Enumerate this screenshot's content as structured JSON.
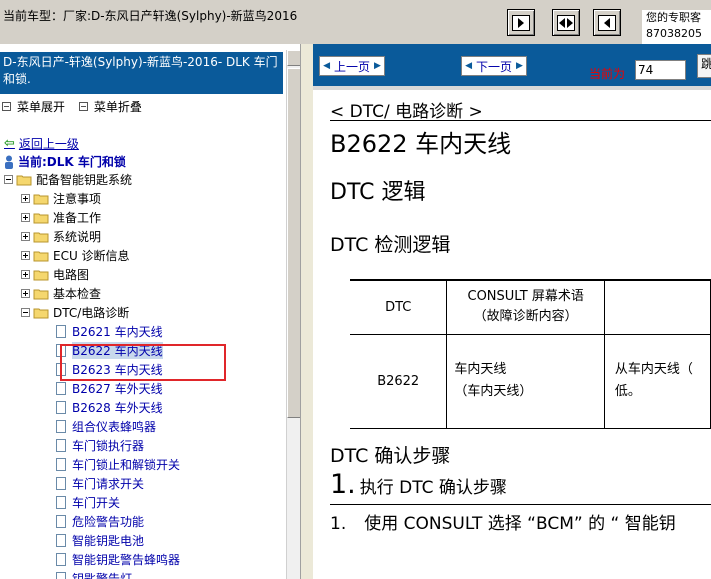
{
  "topbar": {
    "vehicle_label": "当前车型：厂家:D-东风日产轩逸(Sylphy)-新蓝鸟2016",
    "contact_line1": "您的专职客",
    "contact_line2": "87038205"
  },
  "left": {
    "title": "D-东风日产-轩逸(Sylphy)-新蓝鸟-2016- DLK 车门和锁.",
    "expand_label": "菜单展开",
    "collapse_label": "菜单折叠",
    "back_label": "返回上一级",
    "current_label": "当前:DLK 车门和锁",
    "tree": [
      {
        "label": "配备智能钥匙系统",
        "kind": "folder",
        "expanded": true
      },
      {
        "label": "注意事项",
        "kind": "folder",
        "expanded": false
      },
      {
        "label": "准备工作",
        "kind": "folder",
        "expanded": false
      },
      {
        "label": "系统说明",
        "kind": "folder",
        "expanded": false
      },
      {
        "label": "ECU 诊断信息",
        "kind": "folder",
        "expanded": false
      },
      {
        "label": "电路图",
        "kind": "folder",
        "expanded": false
      },
      {
        "label": "基本检查",
        "kind": "folder",
        "expanded": false
      },
      {
        "label": "DTC/电路诊断",
        "kind": "folder",
        "expanded": true
      },
      {
        "label": "B2621 车内天线",
        "kind": "doc"
      },
      {
        "label": "B2622 车内天线",
        "kind": "doc",
        "selected": true
      },
      {
        "label": "B2623 车内天线",
        "kind": "doc"
      },
      {
        "label": "B2627 车外天线",
        "kind": "doc"
      },
      {
        "label": "B2628 车外天线",
        "kind": "doc"
      },
      {
        "label": "组合仪表蜂鸣器",
        "kind": "doc"
      },
      {
        "label": "车门锁执行器",
        "kind": "doc"
      },
      {
        "label": "车门锁止和解锁开关",
        "kind": "doc"
      },
      {
        "label": "车门请求开关",
        "kind": "doc"
      },
      {
        "label": "车门开关",
        "kind": "doc"
      },
      {
        "label": "危险警告功能",
        "kind": "doc"
      },
      {
        "label": "智能钥匙电池",
        "kind": "doc"
      },
      {
        "label": "智能钥匙警告蜂鸣器",
        "kind": "doc"
      },
      {
        "label": "钥匙警告灯",
        "kind": "doc"
      }
    ]
  },
  "right": {
    "prev_label": "上一页",
    "next_label": "下一页",
    "current_page_label": "当前为",
    "page_value": "74",
    "jump_label": "跳",
    "crumb": "< DTC/ 电路诊断 >",
    "code_title": "B2622 车内天线",
    "h_logic": "DTC 逻辑",
    "h_detect": "DTC 检测逻辑",
    "table": {
      "header": {
        "dtc": "DTC",
        "consult_line1": "CONSULT 屏幕术语",
        "consult_line2": "（故障诊断内容）"
      },
      "row": {
        "code": "B2622",
        "name_line1": "车内天线",
        "name_line2": "（车内天线）",
        "cond_line1": "从车内天线（",
        "cond_line2": "低。"
      }
    },
    "h_confirm": "DTC 确认步骤",
    "step_num": "1.",
    "step_text": "执行 DTC 确认步骤",
    "sub_num": "1.",
    "sub_text": "使用 CONSULT 选择 “BCM” 的 “ 智能钥"
  },
  "colors": {
    "toolbar_bg": "#d4d0c8",
    "title_bar": "#0a5a9a",
    "link": "#0000aa",
    "highlight_box": "#e0262a",
    "current_page_label": "#ee0000"
  }
}
